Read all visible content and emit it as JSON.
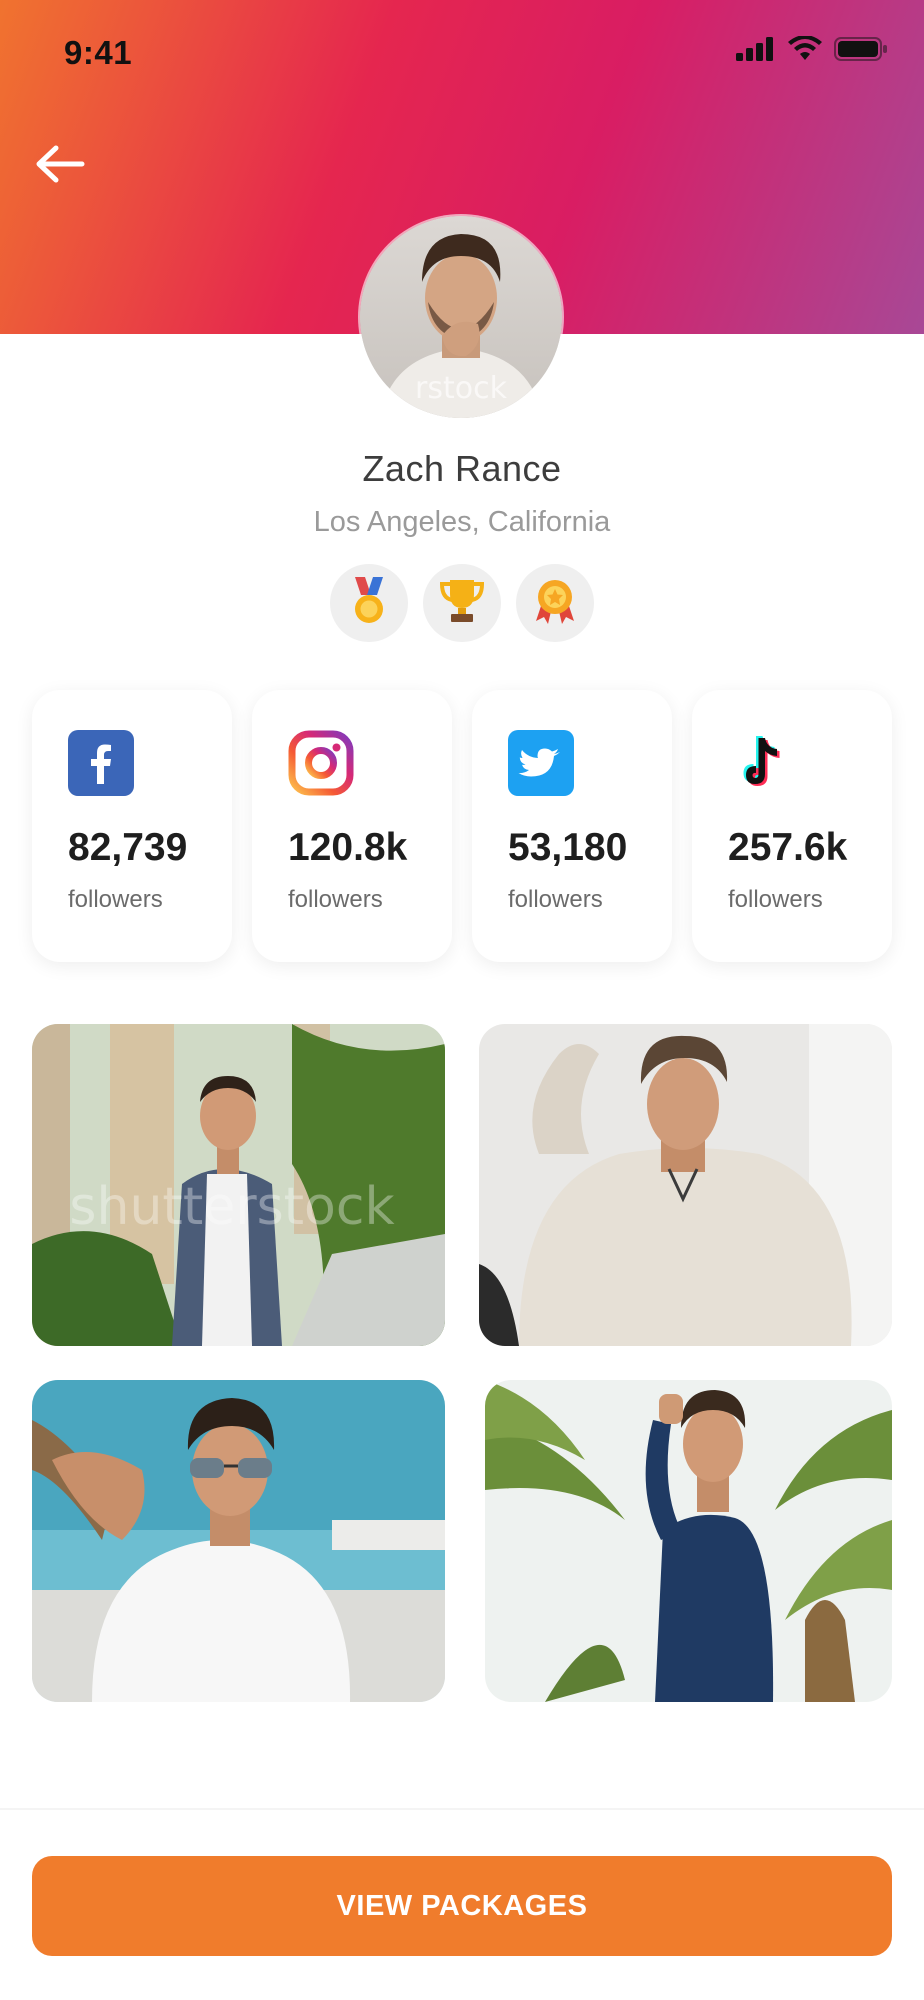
{
  "status_bar": {
    "time": "9:41",
    "icons": [
      "signal-icon",
      "wifi-icon",
      "battery-icon"
    ]
  },
  "nav": {
    "back_icon": "back-arrow-icon"
  },
  "profile": {
    "name": "Zach Rance",
    "location": "Los Angeles, California",
    "badges": [
      "medal-icon",
      "trophy-icon",
      "award-ribbon-icon"
    ]
  },
  "socials": [
    {
      "network_icon": "facebook-icon",
      "count": "82,739",
      "label": "followers",
      "color": "#3b66b8"
    },
    {
      "network_icon": "instagram-icon",
      "count": "120.8k",
      "label": "followers",
      "color": "#e1306c"
    },
    {
      "network_icon": "twitter-icon",
      "count": "53,180",
      "label": "followers",
      "color": "#1da1f2"
    },
    {
      "network_icon": "tiktok-icon",
      "count": "257.6k",
      "label": "followers",
      "color": "#111111"
    }
  ],
  "gallery": {
    "photos": [
      "gallery-photo-1",
      "gallery-photo-2",
      "gallery-photo-3",
      "gallery-photo-4"
    ]
  },
  "cta": {
    "label": "VIEW PACKAGES"
  },
  "theme": {
    "accent": "#f07c2c",
    "gradient_start": "#f0732f",
    "gradient_mid": "#e5264f",
    "gradient_end": "#a84896"
  }
}
